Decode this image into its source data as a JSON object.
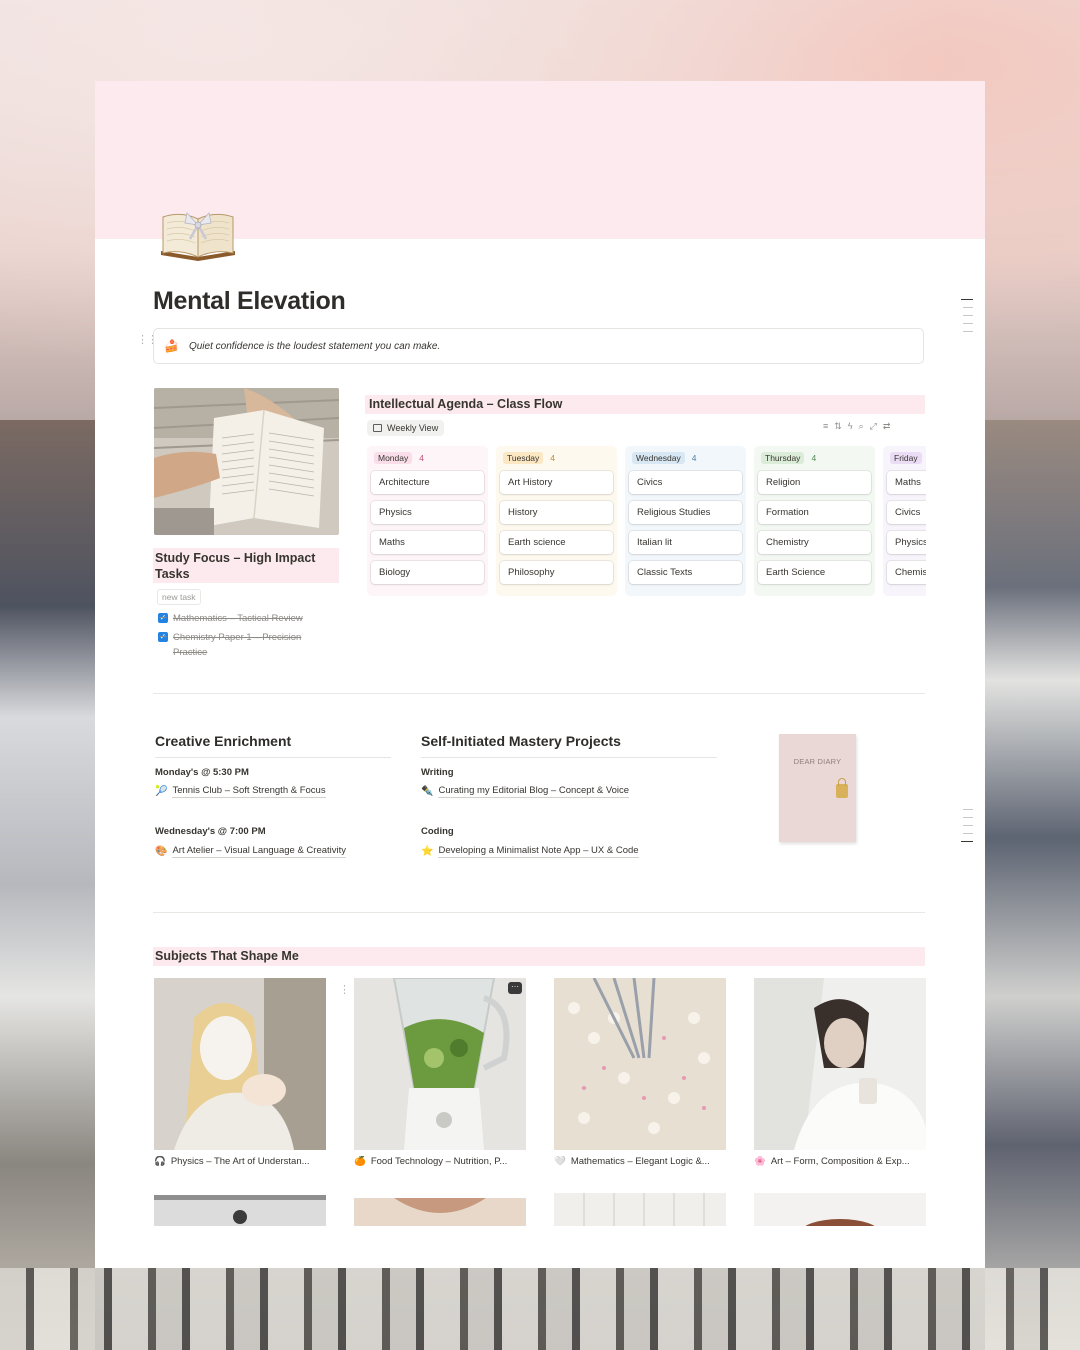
{
  "page": {
    "title": "Mental Elevation",
    "icon": "book-with-bow-icon",
    "quote_emoji": "🍰",
    "quote": "Quiet confidence is the loudest statement you can make."
  },
  "study": {
    "title": "Study Focus – High Impact Tasks",
    "new_task_placeholder": "new task",
    "tasks": [
      {
        "label": "Mathematics – Tactical Review",
        "done": true
      },
      {
        "label": "Chemistry Paper 1 – Precision Practice",
        "done": true
      }
    ]
  },
  "agenda": {
    "title": "Intellectual Agenda – Class Flow",
    "view_label": "Weekly View",
    "tool_icons": [
      "filter-icon",
      "sort-icon",
      "lightning-icon",
      "search-icon",
      "expand-icon",
      "settings-icon"
    ],
    "tool_glyphs": [
      "≡",
      "⇅",
      "ϟ",
      "⌕",
      "⤢",
      "⇄"
    ],
    "columns": [
      {
        "day": "Monday",
        "count": "4",
        "bg": "#fdf5f8",
        "pill": "#f9dde9",
        "count_color": "#c2507a",
        "cards": [
          "Architecture",
          "Physics",
          "Maths",
          "Biology"
        ]
      },
      {
        "day": "Tuesday",
        "count": "4",
        "bg": "#fdf9ef",
        "pill": "#fbe7c2",
        "count_color": "#c48a2c",
        "cards": [
          "Art History",
          "History",
          "Earth science",
          "Philosophy"
        ]
      },
      {
        "day": "Wednesday",
        "count": "4",
        "bg": "#f2f7fb",
        "pill": "#d7e7f4",
        "count_color": "#4b7fa8",
        "cards": [
          "Civics",
          "Religious Studies",
          "Italian lit",
          "Classic Texts"
        ]
      },
      {
        "day": "Thursday",
        "count": "4",
        "bg": "#f4f8f3",
        "pill": "#dbecd9",
        "count_color": "#4c8a55",
        "cards": [
          "Religion",
          "Formation",
          "Chemistry",
          "Earth Science"
        ]
      },
      {
        "day": "Friday",
        "count": "",
        "bg": "#f8f4fb",
        "pill": "#eadcf4",
        "count_color": "#8a5fb0",
        "cards": [
          "Maths",
          "Civics",
          "Physics",
          "Chemis"
        ]
      }
    ]
  },
  "creative": {
    "title": "Creative Enrichment",
    "items": [
      {
        "when": "Monday's @ 5:30 PM",
        "emoji": "🎾",
        "label": "Tennis Club – Soft Strength & Focus"
      },
      {
        "when": "Wednesday's @ 7:00 PM",
        "emoji": "🎨",
        "label": "Art Atelier – Visual Language & Creativity"
      }
    ]
  },
  "mastery": {
    "title": "Self-Initiated Mastery Projects",
    "items": [
      {
        "when": "Writing",
        "emoji": "✒️",
        "label": "Curating my Editorial Blog – Concept & Voice"
      },
      {
        "when": "Coding",
        "emoji": "⭐",
        "label": "Developing a Minimalist Note App – UX & Code"
      }
    ]
  },
  "diary": {
    "text": "DEAR DIARY"
  },
  "subjects": {
    "title": "Subjects That Shape Me",
    "cards": [
      {
        "emoji": "🎧",
        "label": "Physics – The Art of Understan..."
      },
      {
        "emoji": "🍊",
        "label": "Food Technology – Nutrition, P..."
      },
      {
        "emoji": "🤍",
        "label": "Mathematics – Elegant Logic &..."
      },
      {
        "emoji": "🌸",
        "label": "Art – Form, Composition & Exp..."
      }
    ]
  }
}
